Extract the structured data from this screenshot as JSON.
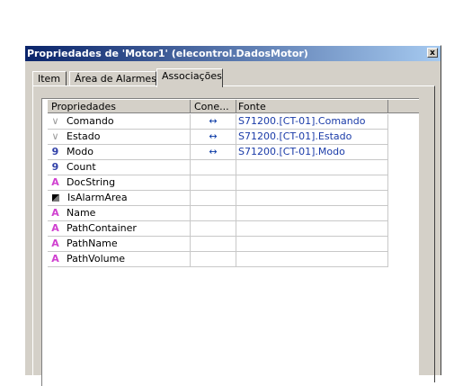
{
  "window": {
    "title": "Propriedades de 'Motor1' (elecontrol.DadosMotor)",
    "close_label": "x"
  },
  "tabs": [
    {
      "label": "Item"
    },
    {
      "label": "Área de Alarmes"
    },
    {
      "label": "Associações"
    }
  ],
  "table": {
    "columns": [
      "Propriedades",
      "Cone...",
      "Fonte"
    ],
    "rows": [
      {
        "icon": "variable-icon",
        "name": "Comando",
        "conn": "↔",
        "source": "S71200.[CT-01].Comando"
      },
      {
        "icon": "variable-icon",
        "name": "Estado",
        "conn": "↔",
        "source": "S71200.[CT-01].Estado"
      },
      {
        "icon": "number-icon",
        "name": "Modo",
        "conn": "↔",
        "source": "S71200.[CT-01].Modo"
      },
      {
        "icon": "number-icon",
        "name": "Count",
        "conn": "",
        "source": ""
      },
      {
        "icon": "string-icon",
        "name": "DocString",
        "conn": "",
        "source": ""
      },
      {
        "icon": "boolean-icon",
        "name": "IsAlarmArea",
        "conn": "",
        "source": ""
      },
      {
        "icon": "string-icon",
        "name": "Name",
        "conn": "",
        "source": ""
      },
      {
        "icon": "string-icon",
        "name": "PathContainer",
        "conn": "",
        "source": ""
      },
      {
        "icon": "string-icon",
        "name": "PathName",
        "conn": "",
        "source": ""
      },
      {
        "icon": "string-icon",
        "name": "PathVolume",
        "conn": "",
        "source": ""
      }
    ]
  }
}
